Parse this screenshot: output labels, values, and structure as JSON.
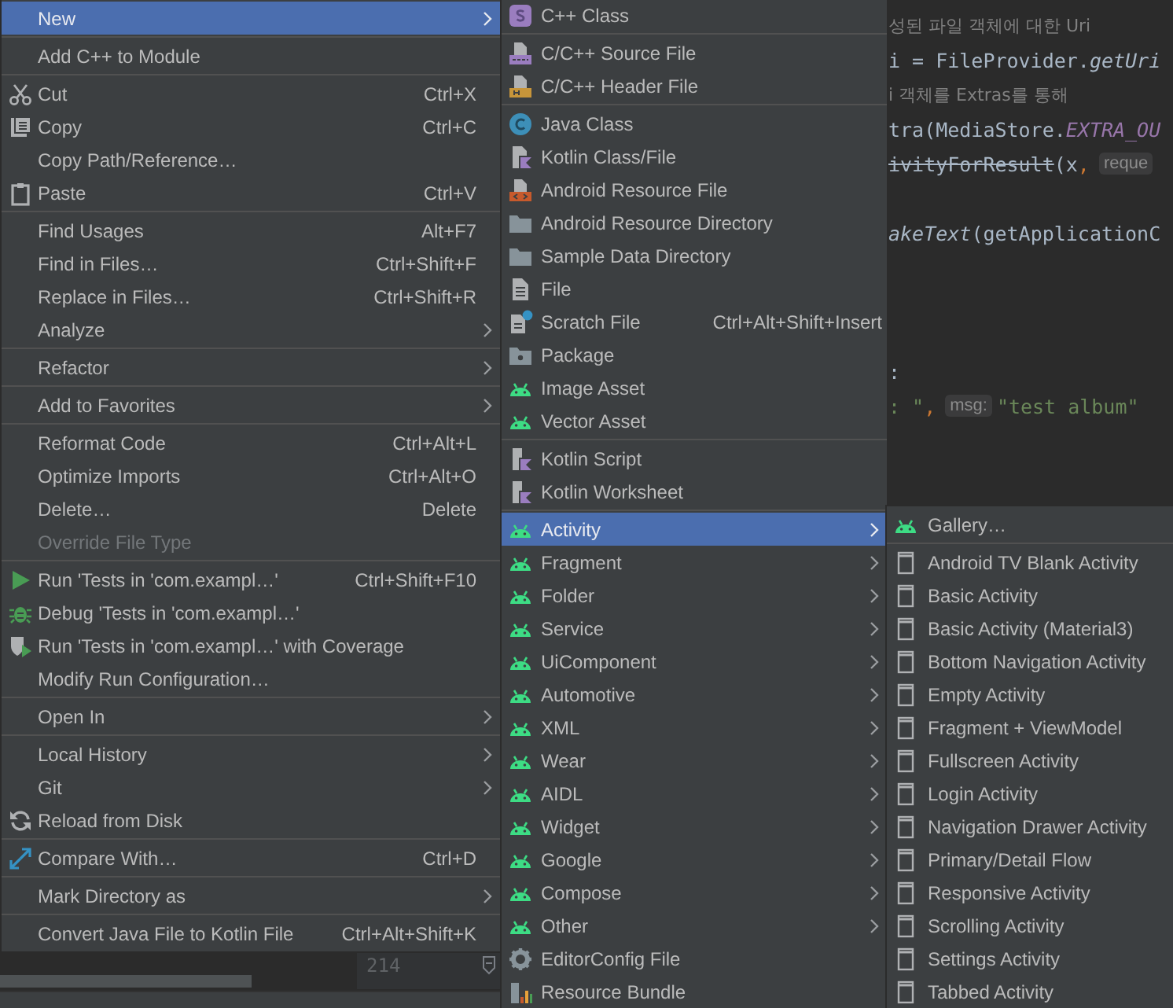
{
  "editor": {
    "lines": [
      {
        "kind": "code",
        "segments": [
          {
            "kind": "comment",
            "text": "성된 파일 객체에 대한 Uri"
          }
        ]
      },
      {
        "kind": "code",
        "segments": [
          {
            "kind": "plain",
            "text": "i = FileProvider."
          },
          {
            "kind": "method",
            "text": "getUri"
          }
        ]
      },
      {
        "kind": "code",
        "segments": [
          {
            "kind": "comment",
            "text": "i 객체를 Extras를 통해"
          }
        ]
      },
      {
        "kind": "code",
        "segments": [
          {
            "kind": "plain",
            "text": "tra(MediaStore."
          },
          {
            "kind": "constant",
            "text": "EXTRA_OU"
          }
        ]
      },
      {
        "kind": "code",
        "segments": [
          {
            "kind": "deprecated",
            "text": "ivityForResult"
          },
          {
            "kind": "plain",
            "text": "(x"
          },
          {
            "kind": "punct",
            "text": ","
          },
          {
            "kind": "hint",
            "text": "reque"
          }
        ]
      },
      {
        "kind": "blank"
      },
      {
        "kind": "code",
        "segments": [
          {
            "kind": "method",
            "text": "akeText"
          },
          {
            "kind": "plain",
            "text": "(getApplicationC"
          }
        ]
      },
      {
        "kind": "blank"
      },
      {
        "kind": "blank"
      },
      {
        "kind": "blank"
      },
      {
        "kind": "code",
        "segments": [
          {
            "kind": "plain",
            "text": ":"
          }
        ]
      },
      {
        "kind": "code",
        "segments": [
          {
            "kind": "string",
            "text": ": \""
          },
          {
            "kind": "punct",
            "text": ","
          },
          {
            "kind": "hint",
            "text": "msg:"
          },
          {
            "kind": "string",
            "text": "\"test album\""
          }
        ]
      }
    ],
    "gutter_line_number": "214"
  },
  "context_menu": {
    "items": [
      {
        "kind": "item",
        "label": "New",
        "submenu": true,
        "selected": true,
        "disabled": false
      },
      {
        "kind": "separator"
      },
      {
        "kind": "item",
        "label": "Add C++ to Module",
        "submenu": false,
        "selected": false,
        "disabled": false
      },
      {
        "kind": "separator"
      },
      {
        "kind": "item",
        "label": "Cut",
        "shortcut": "Ctrl+X",
        "submenu": false,
        "selected": false,
        "disabled": false
      },
      {
        "kind": "item",
        "label": "Copy",
        "shortcut": "Ctrl+C",
        "submenu": false,
        "selected": false,
        "disabled": false
      },
      {
        "kind": "item",
        "label": "Copy Path/Reference…",
        "submenu": false,
        "selected": false,
        "disabled": false
      },
      {
        "kind": "item",
        "label": "Paste",
        "shortcut": "Ctrl+V",
        "submenu": false,
        "selected": false,
        "disabled": false
      },
      {
        "kind": "separator"
      },
      {
        "kind": "item",
        "label": "Find Usages",
        "shortcut": "Alt+F7",
        "submenu": false,
        "selected": false,
        "disabled": false
      },
      {
        "kind": "item",
        "label": "Find in Files…",
        "shortcut": "Ctrl+Shift+F",
        "submenu": false,
        "selected": false,
        "disabled": false
      },
      {
        "kind": "item",
        "label": "Replace in Files…",
        "shortcut": "Ctrl+Shift+R",
        "submenu": false,
        "selected": false,
        "disabled": false
      },
      {
        "kind": "item",
        "label": "Analyze",
        "submenu": true,
        "selected": false,
        "disabled": false
      },
      {
        "kind": "separator"
      },
      {
        "kind": "item",
        "label": "Refactor",
        "submenu": true,
        "selected": false,
        "disabled": false
      },
      {
        "kind": "separator"
      },
      {
        "kind": "item",
        "label": "Add to Favorites",
        "submenu": true,
        "selected": false,
        "disabled": false
      },
      {
        "kind": "separator"
      },
      {
        "kind": "item",
        "label": "Reformat Code",
        "shortcut": "Ctrl+Alt+L",
        "submenu": false,
        "selected": false,
        "disabled": false
      },
      {
        "kind": "item",
        "label": "Optimize Imports",
        "shortcut": "Ctrl+Alt+O",
        "submenu": false,
        "selected": false,
        "disabled": false
      },
      {
        "kind": "item",
        "label": "Delete…",
        "shortcut": "Delete",
        "submenu": false,
        "selected": false,
        "disabled": false
      },
      {
        "kind": "item",
        "label": "Override File Type",
        "submenu": false,
        "selected": false,
        "disabled": true
      },
      {
        "kind": "separator"
      },
      {
        "kind": "item",
        "label": "Run 'Tests in 'com.exampl…'",
        "shortcut": "Ctrl+Shift+F10",
        "submenu": false,
        "selected": false,
        "disabled": false
      },
      {
        "kind": "item",
        "label": "Debug 'Tests in 'com.exampl…'",
        "submenu": false,
        "selected": false,
        "disabled": false
      },
      {
        "kind": "item",
        "label": "Run 'Tests in 'com.exampl…' with Coverage",
        "submenu": false,
        "selected": false,
        "disabled": false
      },
      {
        "kind": "item",
        "label": "Modify Run Configuration…",
        "submenu": false,
        "selected": false,
        "disabled": false
      },
      {
        "kind": "separator"
      },
      {
        "kind": "item",
        "label": "Open In",
        "submenu": true,
        "selected": false,
        "disabled": false
      },
      {
        "kind": "separator"
      },
      {
        "kind": "item",
        "label": "Local History",
        "submenu": true,
        "selected": false,
        "disabled": false
      },
      {
        "kind": "item",
        "label": "Git",
        "submenu": true,
        "selected": false,
        "disabled": false
      },
      {
        "kind": "item",
        "label": "Reload from Disk",
        "submenu": false,
        "selected": false,
        "disabled": false
      },
      {
        "kind": "separator"
      },
      {
        "kind": "item",
        "label": "Compare With…",
        "shortcut": "Ctrl+D",
        "submenu": false,
        "selected": false,
        "disabled": false
      },
      {
        "kind": "separator"
      },
      {
        "kind": "item",
        "label": "Mark Directory as",
        "submenu": true,
        "selected": false,
        "disabled": false
      },
      {
        "kind": "separator"
      },
      {
        "kind": "item",
        "label": "Convert Java File to Kotlin File",
        "shortcut": "Ctrl+Alt+Shift+K",
        "submenu": false,
        "selected": false,
        "disabled": false
      }
    ]
  },
  "new_submenu": {
    "items": [
      {
        "kind": "item",
        "label": "C++ Class",
        "submenu": false,
        "selected": false
      },
      {
        "kind": "separator"
      },
      {
        "kind": "item",
        "label": "C/C++ Source File",
        "submenu": false,
        "selected": false
      },
      {
        "kind": "item",
        "label": "C/C++ Header File",
        "submenu": false,
        "selected": false
      },
      {
        "kind": "separator"
      },
      {
        "kind": "item",
        "label": "Java Class",
        "submenu": false,
        "selected": false
      },
      {
        "kind": "item",
        "label": "Kotlin Class/File",
        "submenu": false,
        "selected": false
      },
      {
        "kind": "item",
        "label": "Android Resource File",
        "submenu": false,
        "selected": false
      },
      {
        "kind": "item",
        "label": "Android Resource Directory",
        "submenu": false,
        "selected": false
      },
      {
        "kind": "item",
        "label": "Sample Data Directory",
        "submenu": false,
        "selected": false
      },
      {
        "kind": "item",
        "label": "File",
        "submenu": false,
        "selected": false
      },
      {
        "kind": "item",
        "label": "Scratch File",
        "shortcut": "Ctrl+Alt+Shift+Insert",
        "submenu": false,
        "selected": false
      },
      {
        "kind": "item",
        "label": "Package",
        "submenu": false,
        "selected": false
      },
      {
        "kind": "item",
        "label": "Image Asset",
        "submenu": false,
        "selected": false
      },
      {
        "kind": "item",
        "label": "Vector Asset",
        "submenu": false,
        "selected": false
      },
      {
        "kind": "separator"
      },
      {
        "kind": "item",
        "label": "Kotlin Script",
        "submenu": false,
        "selected": false
      },
      {
        "kind": "item",
        "label": "Kotlin Worksheet",
        "submenu": false,
        "selected": false
      },
      {
        "kind": "separator"
      },
      {
        "kind": "item",
        "label": "Activity",
        "submenu": true,
        "selected": true
      },
      {
        "kind": "item",
        "label": "Fragment",
        "submenu": true,
        "selected": false
      },
      {
        "kind": "item",
        "label": "Folder",
        "submenu": true,
        "selected": false
      },
      {
        "kind": "item",
        "label": "Service",
        "submenu": true,
        "selected": false
      },
      {
        "kind": "item",
        "label": "UiComponent",
        "submenu": true,
        "selected": false
      },
      {
        "kind": "item",
        "label": "Automotive",
        "submenu": true,
        "selected": false
      },
      {
        "kind": "item",
        "label": "XML",
        "submenu": true,
        "selected": false
      },
      {
        "kind": "item",
        "label": "Wear",
        "submenu": true,
        "selected": false
      },
      {
        "kind": "item",
        "label": "AIDL",
        "submenu": true,
        "selected": false
      },
      {
        "kind": "item",
        "label": "Widget",
        "submenu": true,
        "selected": false
      },
      {
        "kind": "item",
        "label": "Google",
        "submenu": true,
        "selected": false
      },
      {
        "kind": "item",
        "label": "Compose",
        "submenu": true,
        "selected": false
      },
      {
        "kind": "item",
        "label": "Other",
        "submenu": true,
        "selected": false
      },
      {
        "kind": "item",
        "label": "EditorConfig File",
        "submenu": false,
        "selected": false
      },
      {
        "kind": "item",
        "label": "Resource Bundle",
        "submenu": false,
        "selected": false
      }
    ]
  },
  "activity_submenu": {
    "items": [
      {
        "kind": "item",
        "label": "Gallery…",
        "selected": false
      },
      {
        "kind": "separator"
      },
      {
        "kind": "item",
        "label": "Android TV Blank Activity",
        "selected": false
      },
      {
        "kind": "item",
        "label": "Basic Activity",
        "selected": false
      },
      {
        "kind": "item",
        "label": "Basic Activity (Material3)",
        "selected": false
      },
      {
        "kind": "item",
        "label": "Bottom Navigation Activity",
        "selected": false
      },
      {
        "kind": "item",
        "label": "Empty Activity",
        "selected": false
      },
      {
        "kind": "item",
        "label": "Fragment + ViewModel",
        "selected": false
      },
      {
        "kind": "item",
        "label": "Fullscreen Activity",
        "selected": false
      },
      {
        "kind": "item",
        "label": "Login Activity",
        "selected": false
      },
      {
        "kind": "item",
        "label": "Navigation Drawer Activity",
        "selected": false
      },
      {
        "kind": "item",
        "label": "Primary/Detail Flow",
        "selected": false
      },
      {
        "kind": "item",
        "label": "Responsive Activity",
        "selected": false
      },
      {
        "kind": "item",
        "label": "Scrolling Activity",
        "selected": false
      },
      {
        "kind": "item",
        "label": "Settings Activity",
        "selected": false
      },
      {
        "kind": "item",
        "label": "Tabbed Activity",
        "selected": false
      }
    ]
  }
}
